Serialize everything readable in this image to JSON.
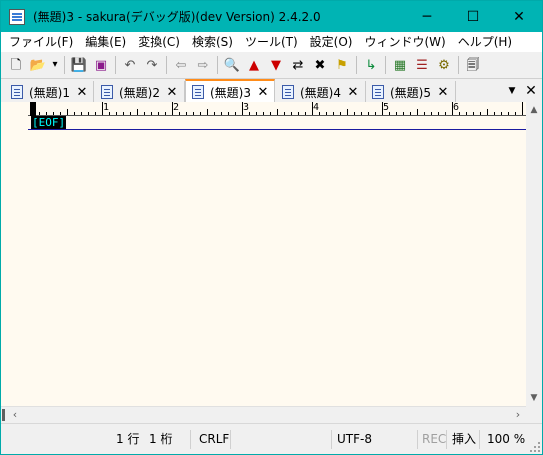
{
  "window": {
    "title": "(無題)3 - sakura(デバッグ版)(dev Version) 2.4.2.0",
    "minimize_glyph": "─",
    "maximize_glyph": "☐",
    "close_glyph": "✕"
  },
  "menu": {
    "items": [
      {
        "label": "ファイル(F)"
      },
      {
        "label": "編集(E)"
      },
      {
        "label": "変換(C)"
      },
      {
        "label": "検索(S)"
      },
      {
        "label": "ツール(T)"
      },
      {
        "label": "設定(O)"
      },
      {
        "label": "ウィンドウ(W)"
      },
      {
        "label": "ヘルプ(H)"
      }
    ]
  },
  "toolbar": {
    "buttons": [
      {
        "name": "new-file-icon",
        "glyph": "🗋"
      },
      {
        "name": "open-folder-icon",
        "glyph": "📂"
      },
      {
        "name": "open-dropdown-icon",
        "glyph": "▾"
      },
      {
        "name": "save-icon",
        "glyph": "💾"
      },
      {
        "name": "save-as-icon",
        "glyph": "▣"
      },
      {
        "name": "undo-icon",
        "glyph": "↶"
      },
      {
        "name": "redo-icon",
        "glyph": "↷"
      },
      {
        "name": "jump-back-icon",
        "glyph": "⇦"
      },
      {
        "name": "jump-forward-icon",
        "glyph": "⇨"
      },
      {
        "name": "search-icon",
        "glyph": "🔍"
      },
      {
        "name": "search-prev-icon",
        "glyph": "▲"
      },
      {
        "name": "search-next-icon",
        "glyph": "▼"
      },
      {
        "name": "replace-icon",
        "glyph": "⇄"
      },
      {
        "name": "clear-mark-icon",
        "glyph": "✖"
      },
      {
        "name": "grep-icon",
        "glyph": "⚑"
      },
      {
        "name": "tag-jump-icon",
        "glyph": "↳"
      },
      {
        "name": "compare-icon",
        "glyph": "▦"
      },
      {
        "name": "outline-icon",
        "glyph": "☰"
      },
      {
        "name": "settings-icon",
        "glyph": "⚙"
      },
      {
        "name": "font-icon",
        "glyph": "🗐"
      }
    ]
  },
  "tabs": [
    {
      "label": "(無題)1",
      "active": false
    },
    {
      "label": "(無題)2",
      "active": false
    },
    {
      "label": "(無題)3",
      "active": true
    },
    {
      "label": "(無題)4",
      "active": false
    },
    {
      "label": "(無題)5",
      "active": false
    }
  ],
  "tab_close_glyph": "✕",
  "tab_dropdown_glyph": "▼",
  "ruler": {
    "numbers": [
      "1",
      "2",
      "3",
      "4",
      "5",
      "6"
    ]
  },
  "editor": {
    "eof_marker": "[EOF]"
  },
  "status": {
    "line": "1 行",
    "column": "1 桁",
    "newline": "CRLF",
    "encoding": "UTF-8",
    "rec": "REC",
    "insert_mode": "挿入",
    "zoom": "100 %"
  },
  "colors": {
    "titlebar": "#00b4b4",
    "editor_bg": "#fffaf0",
    "active_tab_accent": "#ff8c1a",
    "eof_fg": "#00ffff"
  }
}
